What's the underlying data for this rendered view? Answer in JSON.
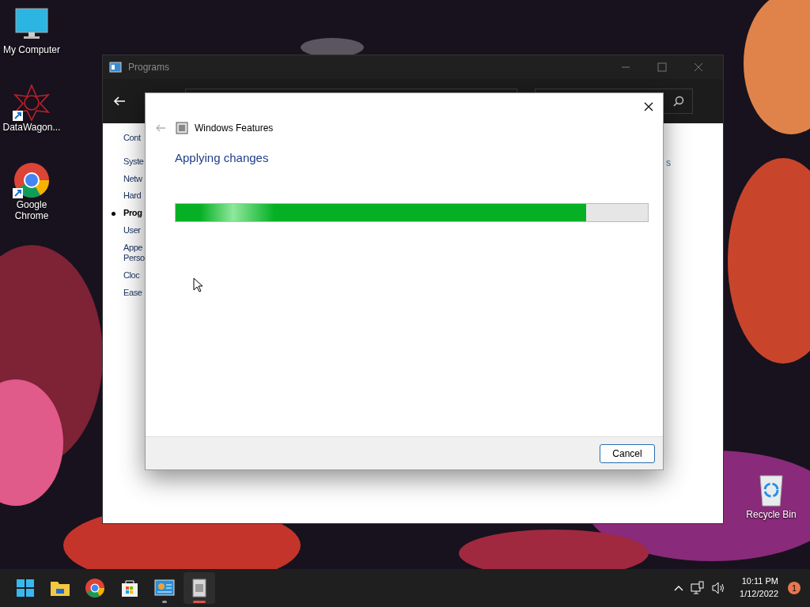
{
  "desktop_icons": [
    {
      "label": "My Computer",
      "kind": "monitor",
      "shortcut": false
    },
    {
      "label": "DataWagon...",
      "kind": "star",
      "shortcut": true
    },
    {
      "label": "Google Chrome",
      "kind": "chrome",
      "shortcut": true
    },
    {
      "label": "Recycle Bin",
      "kind": "bin",
      "shortcut": false
    }
  ],
  "programs_window": {
    "title": "Programs",
    "sidebar": [
      {
        "lines": [
          "Cont"
        ],
        "selected": false
      },
      {
        "lines": [
          "Syste"
        ],
        "selected": false
      },
      {
        "lines": [
          "Netw"
        ],
        "selected": false
      },
      {
        "lines": [
          "Hard"
        ],
        "selected": false
      },
      {
        "lines": [
          "Prog"
        ],
        "selected": true
      },
      {
        "lines": [
          "User"
        ],
        "selected": false
      },
      {
        "lines": [
          "Appe",
          "Perso"
        ],
        "selected": false
      },
      {
        "lines": [
          "Cloc"
        ],
        "selected": false
      },
      {
        "lines": [
          "Ease"
        ],
        "selected": false
      }
    ],
    "fragment": "s"
  },
  "dialog": {
    "title": "Windows Features",
    "back_disabled": true,
    "heading": "Applying changes",
    "progress": {
      "level": 0.87
    },
    "buttons": [
      "Cancel"
    ]
  },
  "taskbar": {
    "apps": [
      {
        "kind": "start",
        "running": false,
        "selected": false
      },
      {
        "kind": "folder",
        "running": false,
        "selected": false
      },
      {
        "kind": "chrome",
        "running": false,
        "selected": false
      },
      {
        "kind": "store",
        "running": false,
        "selected": false
      },
      {
        "kind": "panel",
        "running": true,
        "selected": false
      },
      {
        "kind": "features",
        "running": true,
        "selected": true
      }
    ],
    "time": "10:11 PM",
    "date": "1/12/2022",
    "notification_count": "1"
  }
}
